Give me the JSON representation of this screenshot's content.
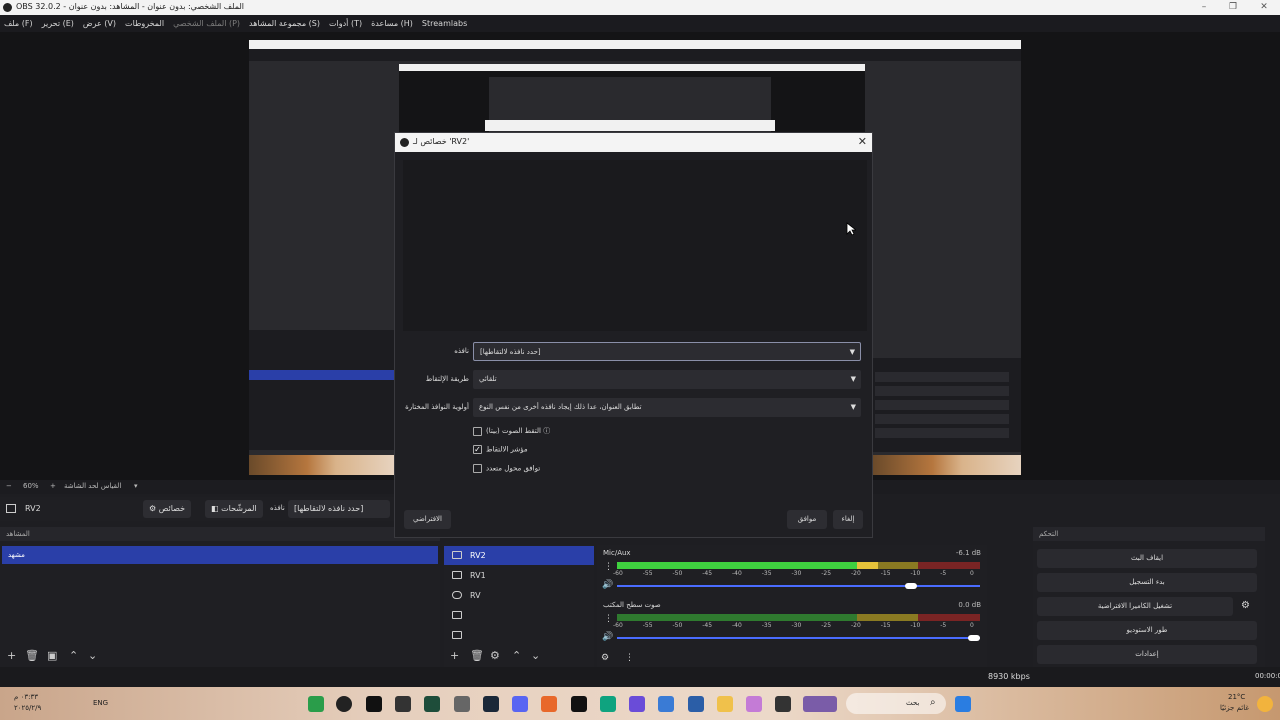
{
  "window": {
    "title": "OBS 32.0.2 - الملف الشخصي: بدون عنوان - المشاهد: بدون عنوان"
  },
  "menu": [
    {
      "label": "ملف (F)",
      "dim": false
    },
    {
      "label": "تحرير (E)",
      "dim": false
    },
    {
      "label": "عرض (V)",
      "dim": false
    },
    {
      "label": "المخروطات",
      "dim": false
    },
    {
      "label": "الملف الشخصي (P)",
      "dim": true
    },
    {
      "label": "مجموعة المشاهد (S)",
      "dim": false
    },
    {
      "label": "أدوات (T)",
      "dim": false
    },
    {
      "label": "مساعدة (H)",
      "dim": false
    },
    {
      "label": "Streamlabs",
      "dim": false
    }
  ],
  "zoombar": {
    "zoom": "60%",
    "scale_label": "القياس لحد الشاشة"
  },
  "source_toolbar": {
    "name": "RV2",
    "properties": "خصائص",
    "filters": "المرشّحات",
    "window_label": "نافذه",
    "window_value": "[حدد نافذه لالتقاطها]"
  },
  "scenes": {
    "title": "المشاهد",
    "items": [
      "مشهد"
    ]
  },
  "sources": {
    "items": [
      "RV2",
      "RV1",
      "RV",
      "",
      ""
    ]
  },
  "mixer": {
    "tracks": [
      {
        "name": "Mic/Aux",
        "db": "-6.1 dB",
        "level": 0.82
      },
      {
        "name": "صوت سطح المكتب",
        "db": "0.0 dB",
        "level": 1.0
      }
    ],
    "scale": [
      "-60",
      "-55",
      "-50",
      "-45",
      "-40",
      "-35",
      "-30",
      "-25",
      "-20",
      "-15",
      "-10",
      "-5",
      "0"
    ]
  },
  "controls": {
    "title": "التحكم",
    "buttons": [
      "ايقاف البث",
      "بدء التسجيل",
      "تشغيل الكاميرا الافتراضية",
      "طور الاستوديو",
      "إعدادات"
    ]
  },
  "status": {
    "bitrate": "8930 kbps",
    "time": "00:00:00"
  },
  "dialog": {
    "title": "خصائص لـ 'RV2'",
    "fields": [
      {
        "label": "نافذه",
        "value": "[حدد نافذه لالتقاطها]"
      },
      {
        "label": "طريقة الإلتقاط",
        "value": "تلقائي"
      },
      {
        "label": "أولوية النوافذ المختارة",
        "value": "تطابق العنوان، عدا ذلك إيجاد نافذه أخرى من نفس النوع"
      }
    ],
    "checkboxes": [
      {
        "label": "التقط الصوت (بيتا)",
        "checked": false
      },
      {
        "label": "مؤشر الالتقاط",
        "checked": true
      },
      {
        "label": "توافق محول متعدد",
        "checked": false
      }
    ],
    "defaults": "الافتراضي",
    "ok": "موافق",
    "cancel": "إلغاء"
  },
  "taskbar": {
    "search": "بحث",
    "lang": "ENG",
    "time": "٠٣:٣٣ م",
    "date": "٢٠٢٥/٢/٩",
    "weather_temp": "21°C",
    "weather_text": "غائم جزئيًا"
  }
}
